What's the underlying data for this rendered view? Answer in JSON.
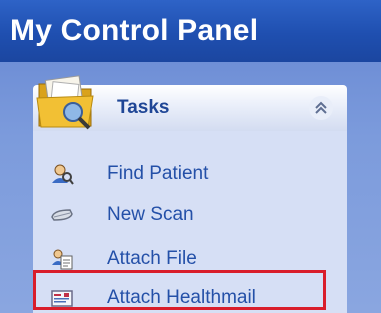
{
  "panel": {
    "title": "My Control Panel"
  },
  "tasks": {
    "title": "Tasks",
    "collapse_glyph": "⌃",
    "items": [
      {
        "label": "Find Patient",
        "icon": "find-patient-icon"
      },
      {
        "label": "New Scan",
        "icon": "scanner-icon"
      },
      {
        "label": "Attach File",
        "icon": "attach-file-icon"
      },
      {
        "label": "Attach Healthmail",
        "icon": "healthmail-icon"
      }
    ]
  },
  "colors": {
    "title_bar": "#1f4fb0",
    "body_bg": "#7c9bdc",
    "link_text": "#2450a8",
    "highlight_border": "#d91d2b"
  }
}
